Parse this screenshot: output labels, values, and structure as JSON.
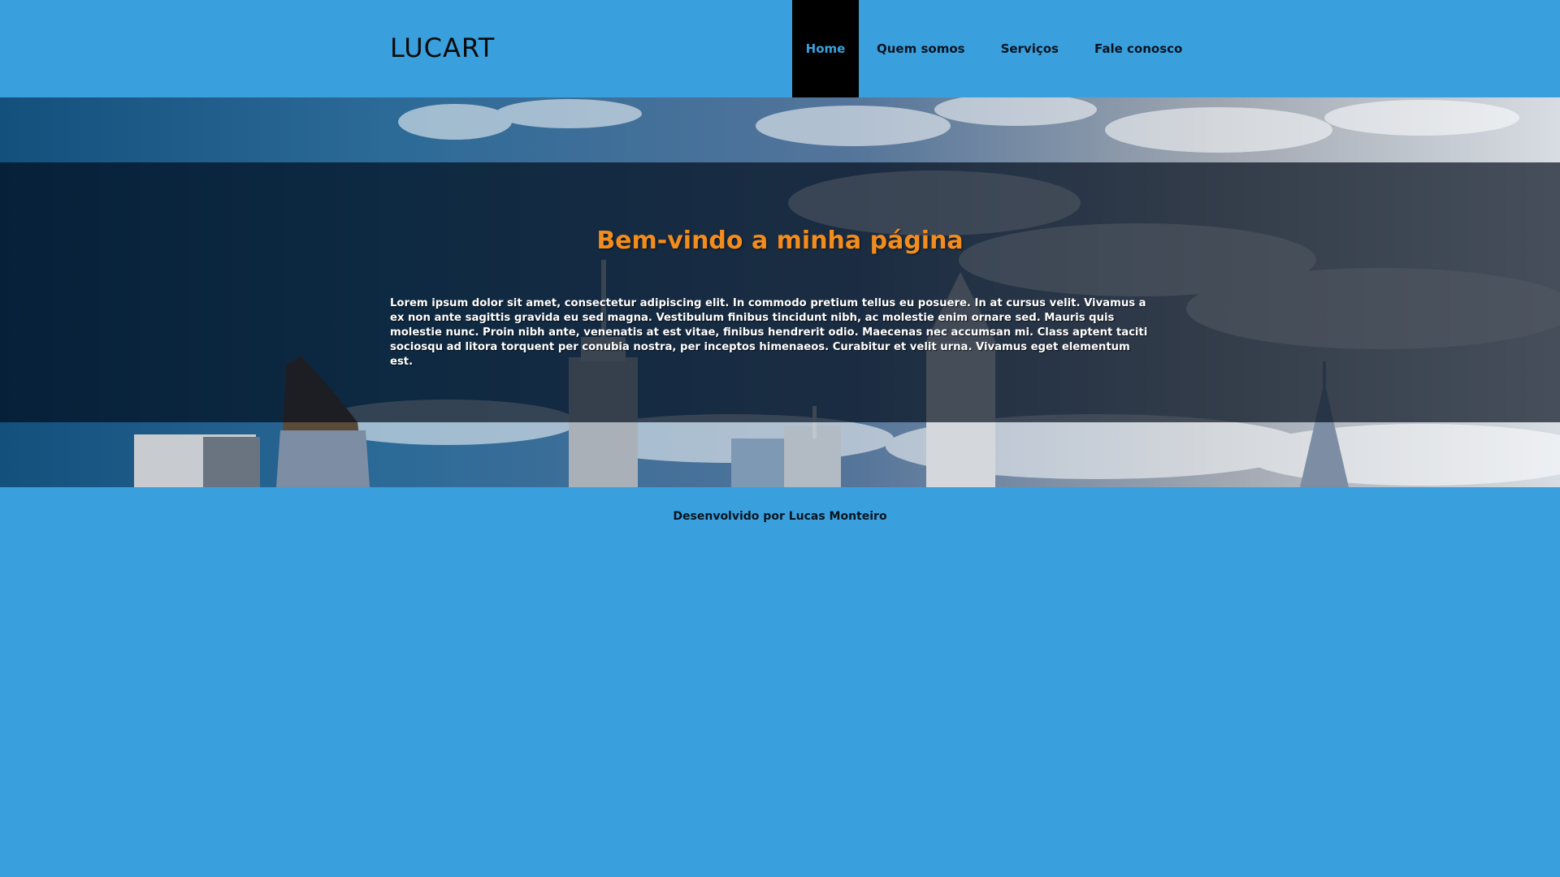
{
  "header": {
    "logo": "LUCART",
    "nav": [
      {
        "label": "Home",
        "active": true
      },
      {
        "label": "Quem somos",
        "active": false
      },
      {
        "label": "Serviços",
        "active": false
      },
      {
        "label": "Fale conosco",
        "active": false
      }
    ]
  },
  "hero": {
    "title": "Bem-vindo a minha página",
    "text": "Lorem ipsum dolor sit amet, consectetur adipiscing elit. In commodo pretium tellus eu posuere. In at cursus velit. Vivamus a ex non ante sagittis gravida eu sed magna. Vestibulum finibus tincidunt nibh, ac molestie enim ornare sed. Mauris quis molestie nunc. Proin nibh ante, venenatis at est vitae, finibus hendrerit odio. Maecenas nec accumsan mi. Class aptent taciti sociosqu ad litora torquent per conubia nostra, per inceptos himenaeos. Curabitur et velit urna. Vivamus eget elementum est."
  },
  "footer": {
    "credit": "Desenvolvido por Lucas Monteiro"
  },
  "colors": {
    "page_background": "#3aa0dd",
    "nav_active_background": "#000000",
    "nav_active_text": "#3aa0dd",
    "hero_title": "#f28c1c"
  }
}
